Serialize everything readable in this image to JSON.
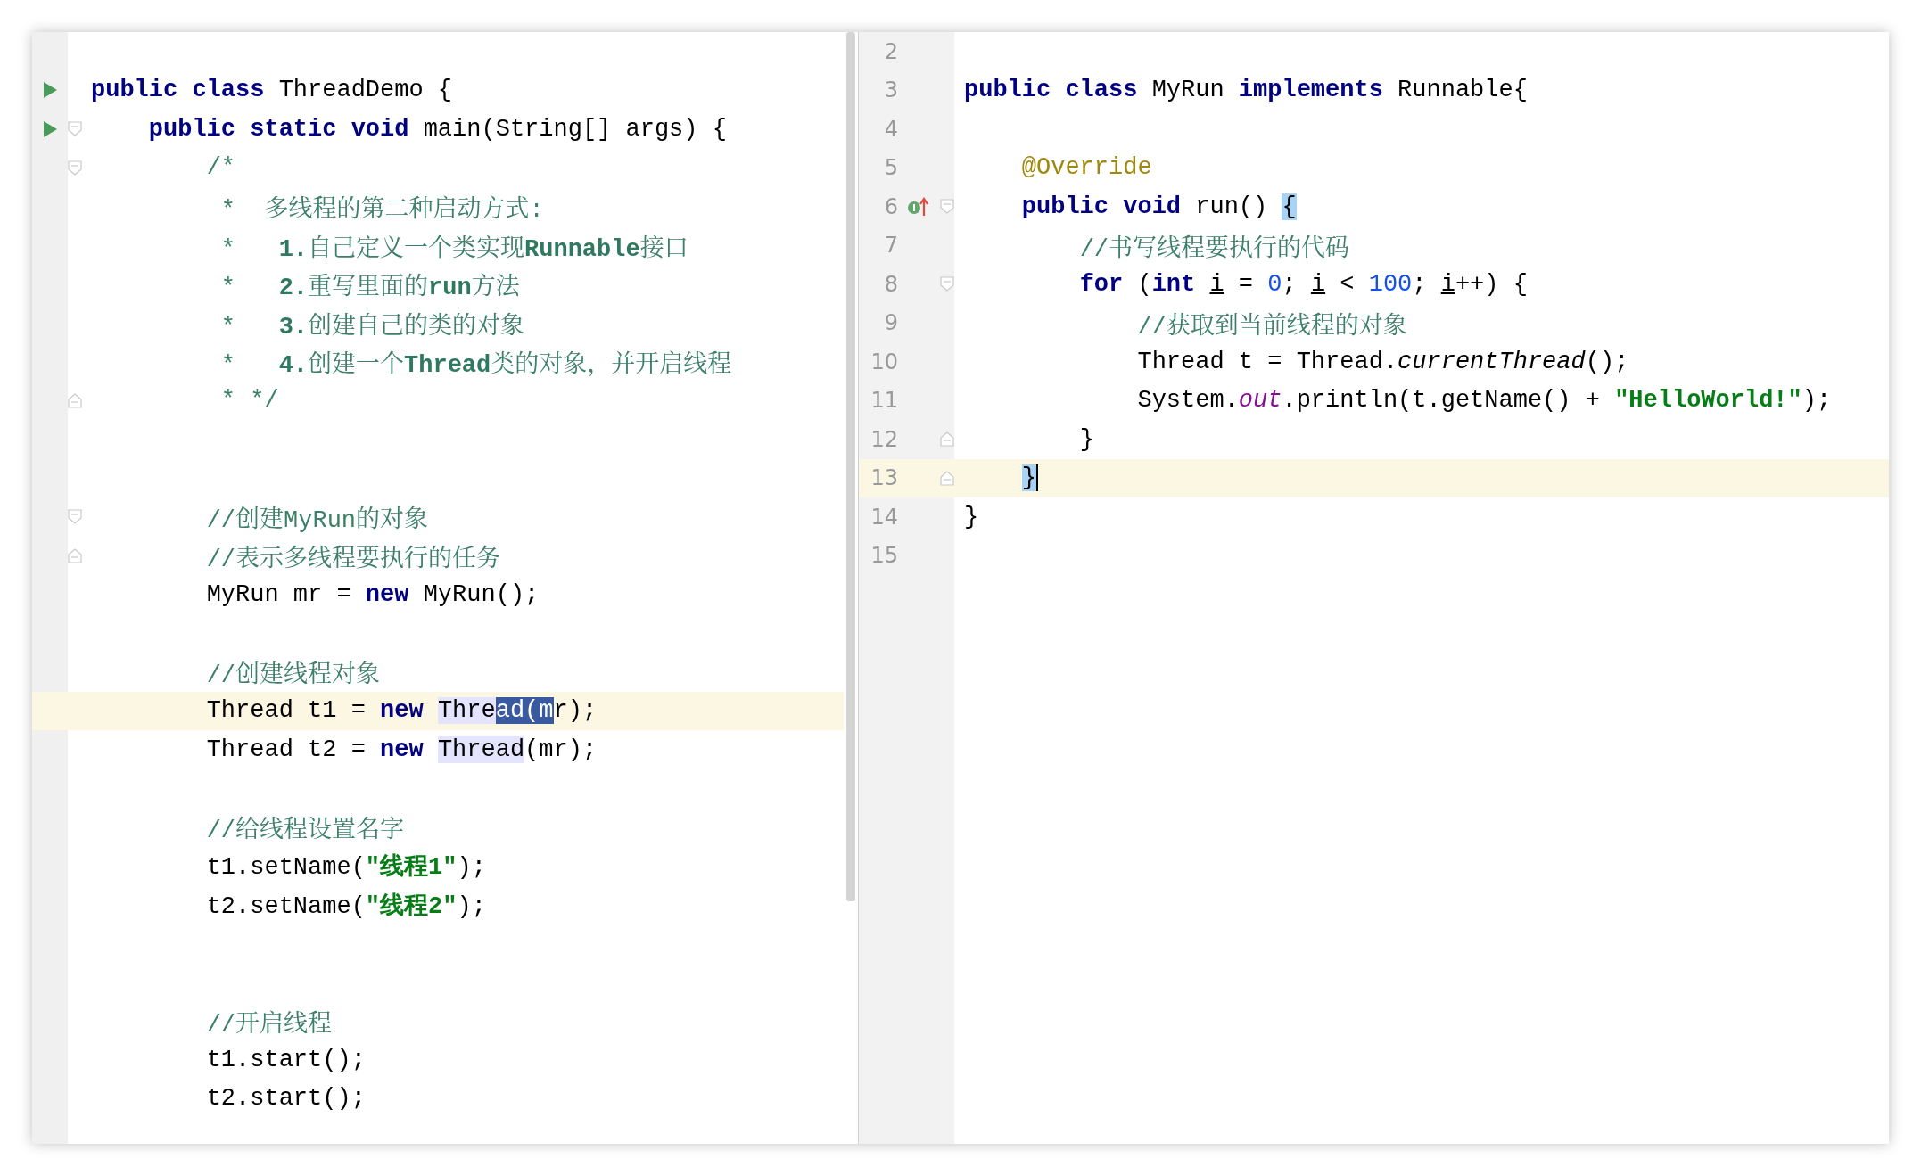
{
  "left_editor": {
    "lines": [
      {
        "current": false
      },
      {
        "current": false,
        "gutter": [
          {
            "kind": "run"
          }
        ],
        "tokens": [
          {
            "kind": "kw",
            "text": "public class "
          },
          {
            "kind": "plain",
            "text": "ThreadDemo {"
          }
        ]
      },
      {
        "current": false,
        "gutter": [
          {
            "kind": "run"
          },
          {
            "kind": "fold-open"
          }
        ],
        "tokens": [
          {
            "kind": "kw",
            "text": "    public static void "
          },
          {
            "kind": "plain",
            "text": "main(String[] args) {"
          }
        ]
      },
      {
        "current": false,
        "gutter": [
          {
            "kind": "fold-open"
          }
        ],
        "tokens": [
          {
            "kind": "doc",
            "text": "        /*"
          }
        ]
      },
      {
        "current": false,
        "tokens": [
          {
            "kind": "doc",
            "text": "         *  多线程的第二种启动方式:"
          }
        ]
      },
      {
        "current": false,
        "tokens": [
          {
            "kind": "doc",
            "text": "         *   "
          },
          {
            "kind": "doc-bold",
            "text": "1."
          },
          {
            "kind": "doc",
            "text": "自己定义一个类实现"
          },
          {
            "kind": "doc-bold",
            "text": "Runnable"
          },
          {
            "kind": "doc",
            "text": "接口"
          }
        ]
      },
      {
        "current": false,
        "tokens": [
          {
            "kind": "doc",
            "text": "         *   "
          },
          {
            "kind": "doc-bold",
            "text": "2."
          },
          {
            "kind": "doc",
            "text": "重写里面的"
          },
          {
            "kind": "doc-bold",
            "text": "run"
          },
          {
            "kind": "doc",
            "text": "方法"
          }
        ]
      },
      {
        "current": false,
        "tokens": [
          {
            "kind": "doc",
            "text": "         *   "
          },
          {
            "kind": "doc-bold",
            "text": "3."
          },
          {
            "kind": "doc",
            "text": "创建自己的类的对象"
          }
        ]
      },
      {
        "current": false,
        "tokens": [
          {
            "kind": "doc",
            "text": "         *   "
          },
          {
            "kind": "doc-bold",
            "text": "4."
          },
          {
            "kind": "doc",
            "text": "创建一个"
          },
          {
            "kind": "doc-bold",
            "text": "Thread"
          },
          {
            "kind": "doc",
            "text": "类的对象，并开启线程"
          }
        ]
      },
      {
        "current": false,
        "gutter": [
          {
            "kind": "fold-close"
          }
        ],
        "tokens": [
          {
            "kind": "doc",
            "text": "         * */"
          }
        ]
      },
      {
        "current": false
      },
      {
        "current": false
      },
      {
        "current": false,
        "gutter": [
          {
            "kind": "fold-open"
          }
        ],
        "tokens": [
          {
            "kind": "comment",
            "text": "        //创建MyRun的对象"
          }
        ]
      },
      {
        "current": false,
        "gutter": [
          {
            "kind": "fold-close"
          }
        ],
        "tokens": [
          {
            "kind": "comment",
            "text": "        //表示多线程要执行的任务"
          }
        ]
      },
      {
        "current": false,
        "tokens": [
          {
            "kind": "plain",
            "text": "        MyRun mr = "
          },
          {
            "kind": "kw",
            "text": "new "
          },
          {
            "kind": "plain",
            "text": "MyRun();"
          }
        ]
      },
      {
        "current": false
      },
      {
        "current": false,
        "tokens": [
          {
            "kind": "comment",
            "text": "        //创建线程对象"
          }
        ]
      },
      {
        "current": true,
        "tokens": [
          {
            "kind": "plain",
            "text": "        Thread t1 = "
          },
          {
            "kind": "kw",
            "text": "new "
          },
          {
            "kind": "occurrence",
            "text": "Thre"
          },
          {
            "kind": "selection",
            "text": "ad(m"
          },
          {
            "kind": "plain",
            "text": "r);"
          }
        ]
      },
      {
        "current": false,
        "tokens": [
          {
            "kind": "plain",
            "text": "        Thread t2 = "
          },
          {
            "kind": "kw",
            "text": "new "
          },
          {
            "kind": "occurrence",
            "text": "Thread"
          },
          {
            "kind": "plain",
            "text": "(mr);"
          }
        ]
      },
      {
        "current": false
      },
      {
        "current": false,
        "tokens": [
          {
            "kind": "comment",
            "text": "        //给线程设置名字"
          }
        ]
      },
      {
        "current": false,
        "tokens": [
          {
            "kind": "plain",
            "text": "        t1.setName("
          },
          {
            "kind": "string",
            "text": "\"线程1\""
          },
          {
            "kind": "plain",
            "text": ");"
          }
        ]
      },
      {
        "current": false,
        "tokens": [
          {
            "kind": "plain",
            "text": "        t2.setName("
          },
          {
            "kind": "string",
            "text": "\"线程2\""
          },
          {
            "kind": "plain",
            "text": ");"
          }
        ]
      },
      {
        "current": false
      },
      {
        "current": false
      },
      {
        "current": false,
        "tokens": [
          {
            "kind": "comment",
            "text": "        //开启线程"
          }
        ]
      },
      {
        "current": false,
        "tokens": [
          {
            "kind": "plain",
            "text": "        t1.start();"
          }
        ]
      },
      {
        "current": false,
        "tokens": [
          {
            "kind": "plain",
            "text": "        t2.start();"
          }
        ]
      }
    ]
  },
  "right_editor": {
    "lines": [
      {
        "number": "2",
        "current": false
      },
      {
        "number": "3",
        "current": false,
        "tokens": [
          {
            "kind": "kw",
            "text": "public class "
          },
          {
            "kind": "plain",
            "text": "MyRun "
          },
          {
            "kind": "kw",
            "text": "implements "
          },
          {
            "kind": "plain",
            "text": "Runnable{"
          }
        ]
      },
      {
        "number": "4",
        "current": false
      },
      {
        "number": "5",
        "current": false,
        "tokens": [
          {
            "kind": "annotation",
            "text": "    @Override"
          }
        ]
      },
      {
        "number": "6",
        "current": false,
        "gutter": [
          {
            "kind": "implements"
          },
          {
            "kind": "fold-open"
          }
        ],
        "tokens": [
          {
            "kind": "kw",
            "text": "    public void "
          },
          {
            "kind": "plain",
            "text": "run() "
          },
          {
            "kind": "brace",
            "text": "{"
          }
        ]
      },
      {
        "number": "7",
        "current": false,
        "tokens": [
          {
            "kind": "comment",
            "text": "        //书写线程要执行的代码"
          }
        ]
      },
      {
        "number": "8",
        "current": false,
        "gutter": [
          {
            "kind": "fold-open"
          }
        ],
        "tokens": [
          {
            "kind": "kw",
            "text": "        for "
          },
          {
            "kind": "plain",
            "text": "("
          },
          {
            "kind": "kw",
            "text": "int "
          },
          {
            "kind": "underline",
            "text": "i"
          },
          {
            "kind": "plain",
            "text": " = "
          },
          {
            "kind": "number",
            "text": "0"
          },
          {
            "kind": "plain",
            "text": "; "
          },
          {
            "kind": "underline",
            "text": "i"
          },
          {
            "kind": "plain",
            "text": " < "
          },
          {
            "kind": "number",
            "text": "100"
          },
          {
            "kind": "plain",
            "text": "; "
          },
          {
            "kind": "underline",
            "text": "i"
          },
          {
            "kind": "plain",
            "text": "++) {"
          }
        ]
      },
      {
        "number": "9",
        "current": false,
        "tokens": [
          {
            "kind": "comment",
            "text": "            //获取到当前线程的对象"
          }
        ]
      },
      {
        "number": "10",
        "current": false,
        "tokens": [
          {
            "kind": "plain",
            "text": "            Thread t = Thread."
          },
          {
            "kind": "italic",
            "text": "currentThread"
          },
          {
            "kind": "plain",
            "text": "();"
          }
        ]
      },
      {
        "number": "11",
        "current": false,
        "tokens": [
          {
            "kind": "plain",
            "text": "            System."
          },
          {
            "kind": "field",
            "text": "out"
          },
          {
            "kind": "plain",
            "text": ".println(t.getName() + "
          },
          {
            "kind": "string",
            "text": "\"HelloWorld!\""
          },
          {
            "kind": "plain",
            "text": ");"
          }
        ]
      },
      {
        "number": "12",
        "current": false,
        "gutter": [
          {
            "kind": "fold-close"
          }
        ],
        "tokens": [
          {
            "kind": "plain",
            "text": "        }"
          }
        ]
      },
      {
        "number": "13",
        "current": true,
        "gutter": [
          {
            "kind": "fold-close"
          }
        ],
        "tokens": [
          {
            "kind": "brace-caret",
            "text": "    }"
          }
        ]
      },
      {
        "number": "14",
        "current": false,
        "tokens": [
          {
            "kind": "plain",
            "text": "}"
          }
        ]
      },
      {
        "number": "15",
        "current": false
      }
    ]
  }
}
